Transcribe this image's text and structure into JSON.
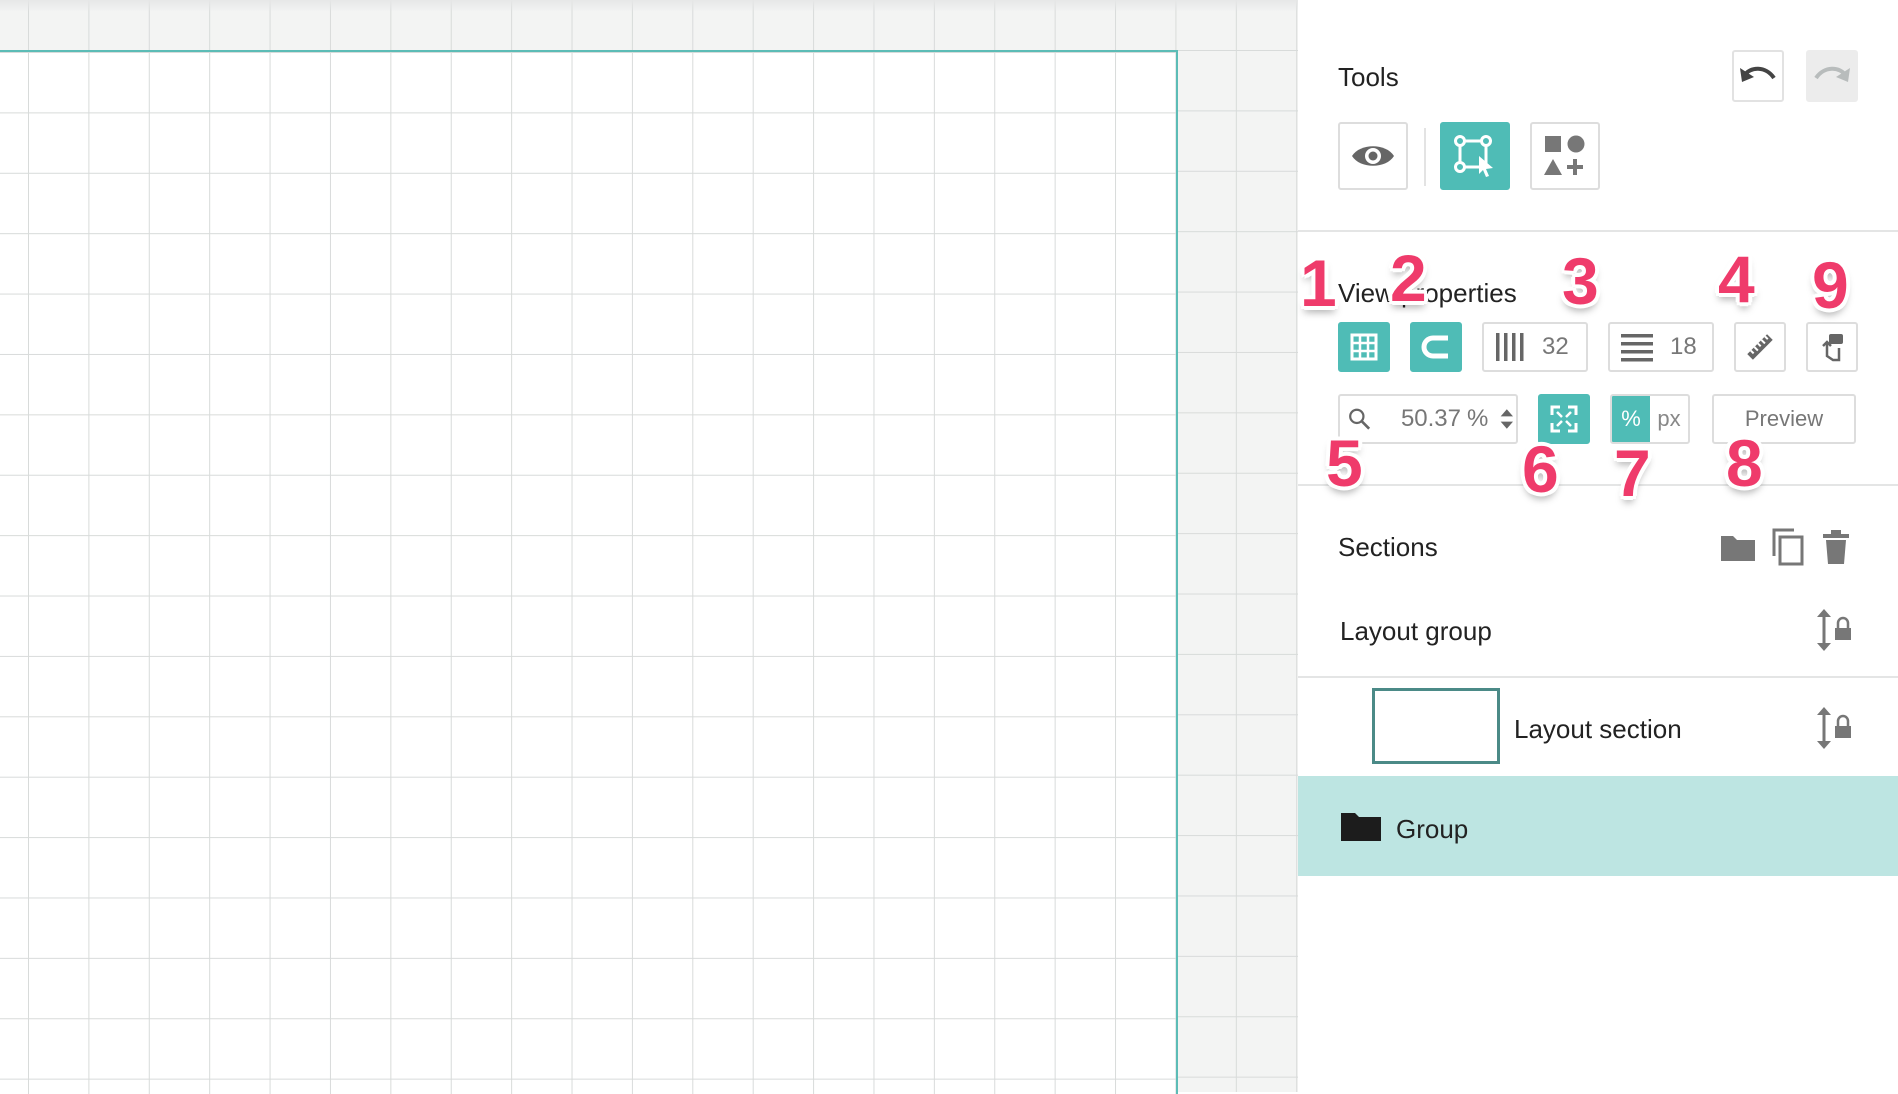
{
  "tools": {
    "title": "Tools",
    "undo_icon": "undo-icon",
    "redo_icon": "redo-icon",
    "buttons": [
      "eye-icon",
      "select-transform-icon",
      "add-shapes-icon"
    ]
  },
  "view_properties": {
    "title": "View properties",
    "columns_value": "32",
    "rows_value": "18",
    "zoom_value": "50.37",
    "zoom_unit": "%",
    "unit_percent": "%",
    "unit_px": "px",
    "preview_label": "Preview"
  },
  "annotations": [
    "1",
    "2",
    "3",
    "4",
    "5",
    "6",
    "7",
    "8",
    "9"
  ],
  "sections": {
    "title": "Sections",
    "items": [
      {
        "label": "Layout group"
      },
      {
        "label": "Layout section"
      },
      {
        "label": "Group"
      }
    ]
  },
  "colors": {
    "accent": "#4fbcb6",
    "selected_row": "#bde5e2",
    "annotation": "#ef3b6b",
    "artboard_border": "#5cbcb6"
  }
}
